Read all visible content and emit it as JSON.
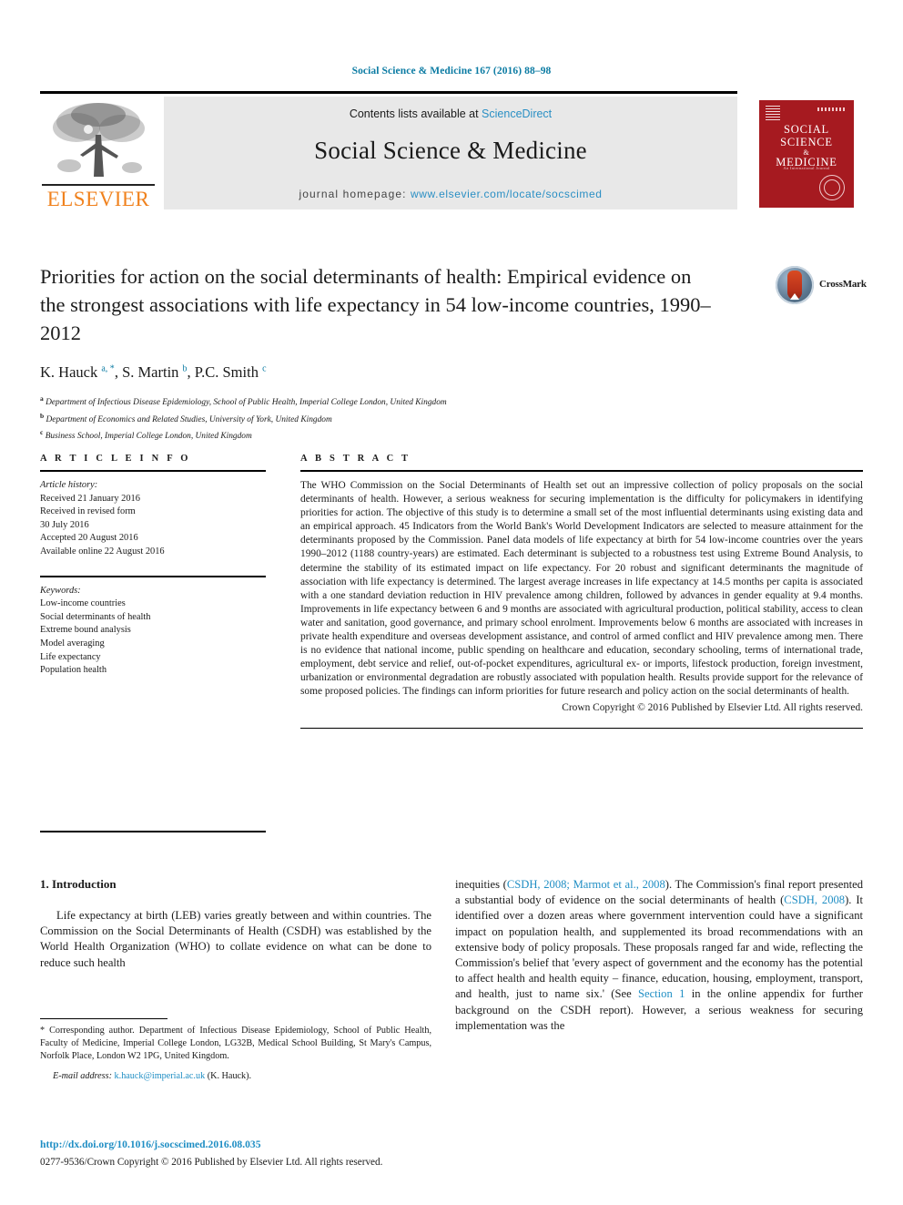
{
  "running_head": "Social Science & Medicine 167 (2016) 88–98",
  "masthead": {
    "contents_prefix": "Contents lists available at ",
    "sciencedirect": "ScienceDirect",
    "journal_name": "Social Science & Medicine",
    "homepage_prefix": "journal homepage: ",
    "homepage_url": "www.elsevier.com/locate/socscimed",
    "publisher_logo_text": "ELSEVIER",
    "cover_title_line1": "SOCIAL",
    "cover_title_line2": "SCIENCE",
    "cover_title_amp": "&",
    "cover_title_line3": "MEDICINE",
    "cover_subtitle": "An International Journal"
  },
  "article": {
    "title": "Priorities for action on the social determinants of health: Empirical evidence on the strongest associations with life expectancy in 54 low-income countries, 1990–2012",
    "crossmark_label": "CrossMark",
    "authors_html": "K. Hauck <sup>a, *</sup>, S. Martin <sup>b</sup>, P.C. Smith <sup>c</sup>",
    "affiliations": [
      {
        "marker": "a",
        "text": "Department of Infectious Disease Epidemiology, School of Public Health, Imperial College London, United Kingdom"
      },
      {
        "marker": "b",
        "text": "Department of Economics and Related Studies, University of York, United Kingdom"
      },
      {
        "marker": "c",
        "text": "Business School, Imperial College London, United Kingdom"
      }
    ]
  },
  "article_info": {
    "heading": "A R T I C L E  I N F O",
    "history_label": "Article history:",
    "history": [
      "Received 21 January 2016",
      "Received in revised form",
      "30 July 2016",
      "Accepted 20 August 2016",
      "Available online 22 August 2016"
    ],
    "keywords_label": "Keywords:",
    "keywords": [
      "Low-income countries",
      "Social determinants of health",
      "Extreme bound analysis",
      "Model averaging",
      "Life expectancy",
      "Population health"
    ]
  },
  "abstract": {
    "heading": "A B S T R A C T",
    "text": "The WHO Commission on the Social Determinants of Health set out an impressive collection of policy proposals on the social determinants of health. However, a serious weakness for securing implementation is the difficulty for policymakers in identifying priorities for action. The objective of this study is to determine a small set of the most influential determinants using existing data and an empirical approach. 45 Indicators from the World Bank's World Development Indicators are selected to measure attainment for the determinants proposed by the Commission. Panel data models of life expectancy at birth for 54 low-income countries over the years 1990–2012 (1188 country-years) are estimated. Each determinant is subjected to a robustness test using Extreme Bound Analysis, to determine the stability of its estimated impact on life expectancy. For 20 robust and significant determinants the magnitude of association with life expectancy is determined. The largest average increases in life expectancy at 14.5 months per capita is associated with a one standard deviation reduction in HIV prevalence among children, followed by advances in gender equality at 9.4 months. Improvements in life expectancy between 6 and 9 months are associated with agricultural production, political stability, access to clean water and sanitation, good governance, and primary school enrolment. Improvements below 6 months are associated with increases in private health expenditure and overseas development assistance, and control of armed conflict and HIV prevalence among men. There is no evidence that national income, public spending on healthcare and education, secondary schooling, terms of international trade, employment, debt service and relief, out-of-pocket expenditures, agricultural ex- or imports, lifestock production, foreign investment, urbanization or environmental degradation are robustly associated with population health. Results provide support for the relevance of some proposed policies. The findings can inform priorities for future research and policy action on the social determinants of health.",
    "copyright": "Crown Copyright © 2016 Published by Elsevier Ltd. All rights reserved."
  },
  "body": {
    "section_number_title": "1. Introduction",
    "left_paragraph": "Life expectancy at birth (LEB) varies greatly between and within countries. The Commission on the Social Determinants of Health (CSDH) was established by the World Health Organization (WHO) to collate evidence on what can be done to reduce such health",
    "right_paragraph_parts": [
      {
        "type": "text",
        "value": "inequities ("
      },
      {
        "type": "link",
        "value": "CSDH, 2008; Marmot et al., 2008"
      },
      {
        "type": "text",
        "value": "). The Commission's final report presented a substantial body of evidence on the social determinants of health ("
      },
      {
        "type": "link",
        "value": "CSDH, 2008"
      },
      {
        "type": "text",
        "value": "). It identified over a dozen areas where government intervention could have a significant impact on population health, and supplemented its broad recommendations with an extensive body of policy proposals. These proposals ranged far and wide, reflecting the Commission's belief that 'every aspect of government and the economy has the potential to affect health and health equity – finance, education, housing, employment, transport, and health, just to name six.' (See "
      },
      {
        "type": "link",
        "value": "Section 1"
      },
      {
        "type": "text",
        "value": " in the online appendix for further background on the CSDH report). However, a serious weakness for securing implementation was the"
      }
    ]
  },
  "footnote": {
    "corresponding": "* Corresponding author. Department of Infectious Disease Epidemiology, School of Public Health, Faculty of Medicine, Imperial College London, LG32B, Medical School Building, St Mary's Campus, Norfolk Place, London W2 1PG, United Kingdom.",
    "email_label": "E-mail address:",
    "email": "k.hauck@imperial.ac.uk",
    "email_suffix": "(K. Hauck)."
  },
  "doi": {
    "url": "http://dx.doi.org/10.1016/j.socscimed.2016.08.035",
    "issn_line": "0277-9536/Crown Copyright © 2016 Published by Elsevier Ltd. All rights reserved."
  },
  "colors": {
    "link_blue": "#1f8ec4",
    "running_head_teal": "#0b7ba3",
    "elsevier_orange": "#f0821e",
    "cover_red": "#a61a20"
  }
}
